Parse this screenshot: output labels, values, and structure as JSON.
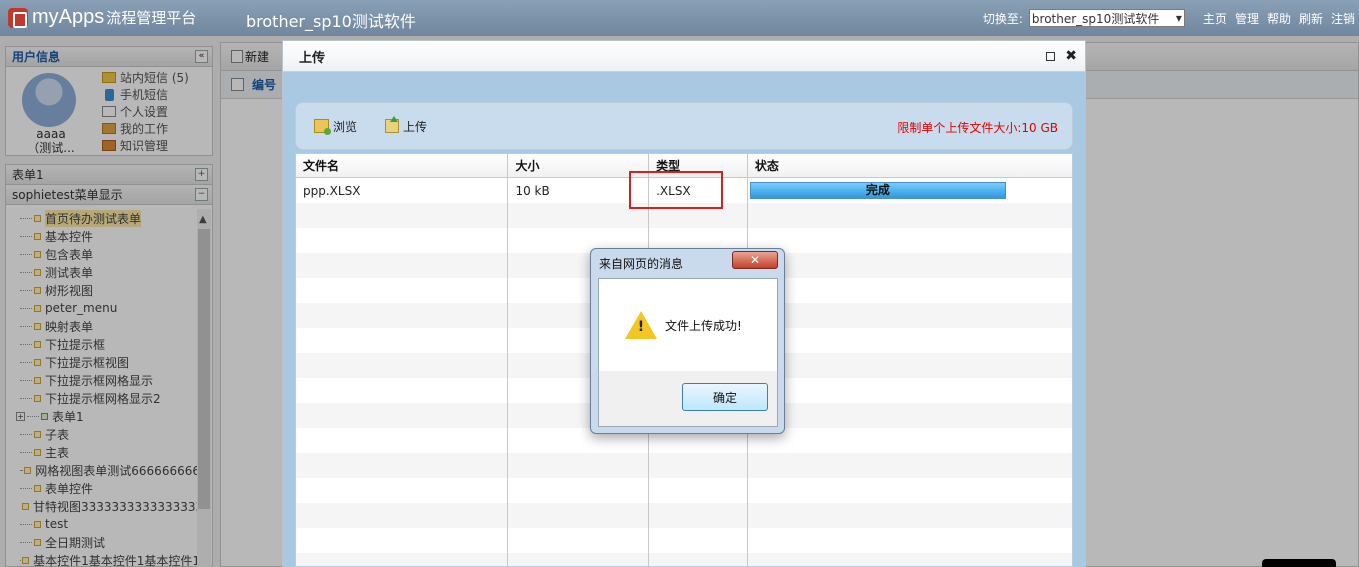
{
  "topbar": {
    "logo_name": "myApps",
    "logo_sub": "流程管理平台",
    "app_title": "brother_sp10测试软件",
    "switch_label": "切换至:",
    "switch_value": "brother_sp10测试软件",
    "links": [
      "主页",
      "管理",
      "帮助",
      "刷新",
      "注销"
    ]
  },
  "user_panel": {
    "title": "用户信息",
    "collapse_icon": "«",
    "user_name": "aaaa",
    "user_sub": "（测试...",
    "links": [
      {
        "label": "站内短信 (5)",
        "icon": "mail-icon"
      },
      {
        "label": "手机短信",
        "icon": "phone-icon"
      },
      {
        "label": "个人设置",
        "icon": "edit-icon"
      },
      {
        "label": "我的工作",
        "icon": "work-icon"
      },
      {
        "label": "知识管理",
        "icon": "knowledge-icon"
      }
    ]
  },
  "menu_panel": {
    "form_header": "表单1",
    "form_header_btn": "+",
    "menu_header": "sophietest菜单显示",
    "menu_header_btn": "−",
    "items": [
      {
        "label": "首页待办测试表单",
        "selected": true
      },
      {
        "label": "基本控件"
      },
      {
        "label": "包含表单"
      },
      {
        "label": "测试表单"
      },
      {
        "label": "树形视图"
      },
      {
        "label": "peter_menu"
      },
      {
        "label": "映射表单"
      },
      {
        "label": "下拉提示框"
      },
      {
        "label": "下拉提示框视图"
      },
      {
        "label": "下拉提示框网格显示"
      },
      {
        "label": "下拉提示框网格显示2"
      },
      {
        "label": "表单1",
        "folder": true
      },
      {
        "label": "子表"
      },
      {
        "label": "主表"
      },
      {
        "label": "网格视图表单测试666666666"
      },
      {
        "label": "表单控件"
      },
      {
        "label": "甘特视图3333333333333333"
      },
      {
        "label": "test"
      },
      {
        "label": "全日期测试"
      },
      {
        "label": "基本控件1基本控件1基本控件1"
      }
    ]
  },
  "main": {
    "new_label": "新建",
    "col_number": "编号"
  },
  "upload_dialog": {
    "title": "上传",
    "browse_label": "浏览",
    "upload_label": "上传",
    "limit_text": "限制单个上传文件大小:10 GB",
    "columns": [
      "文件名",
      "大小",
      "类型",
      "状态"
    ],
    "rows": [
      {
        "name": "ppp.XLSX",
        "size": "10 kB",
        "type": ".XLSX",
        "status": "完成",
        "progress": 100
      }
    ]
  },
  "alert": {
    "title": "来自网页的消息",
    "close_label": "✕",
    "message": "文件上传成功!",
    "ok_label": "确定"
  },
  "colors": {
    "accent": "#1f5da8",
    "limit_text": "#e60000",
    "highlight": "#d92020"
  }
}
